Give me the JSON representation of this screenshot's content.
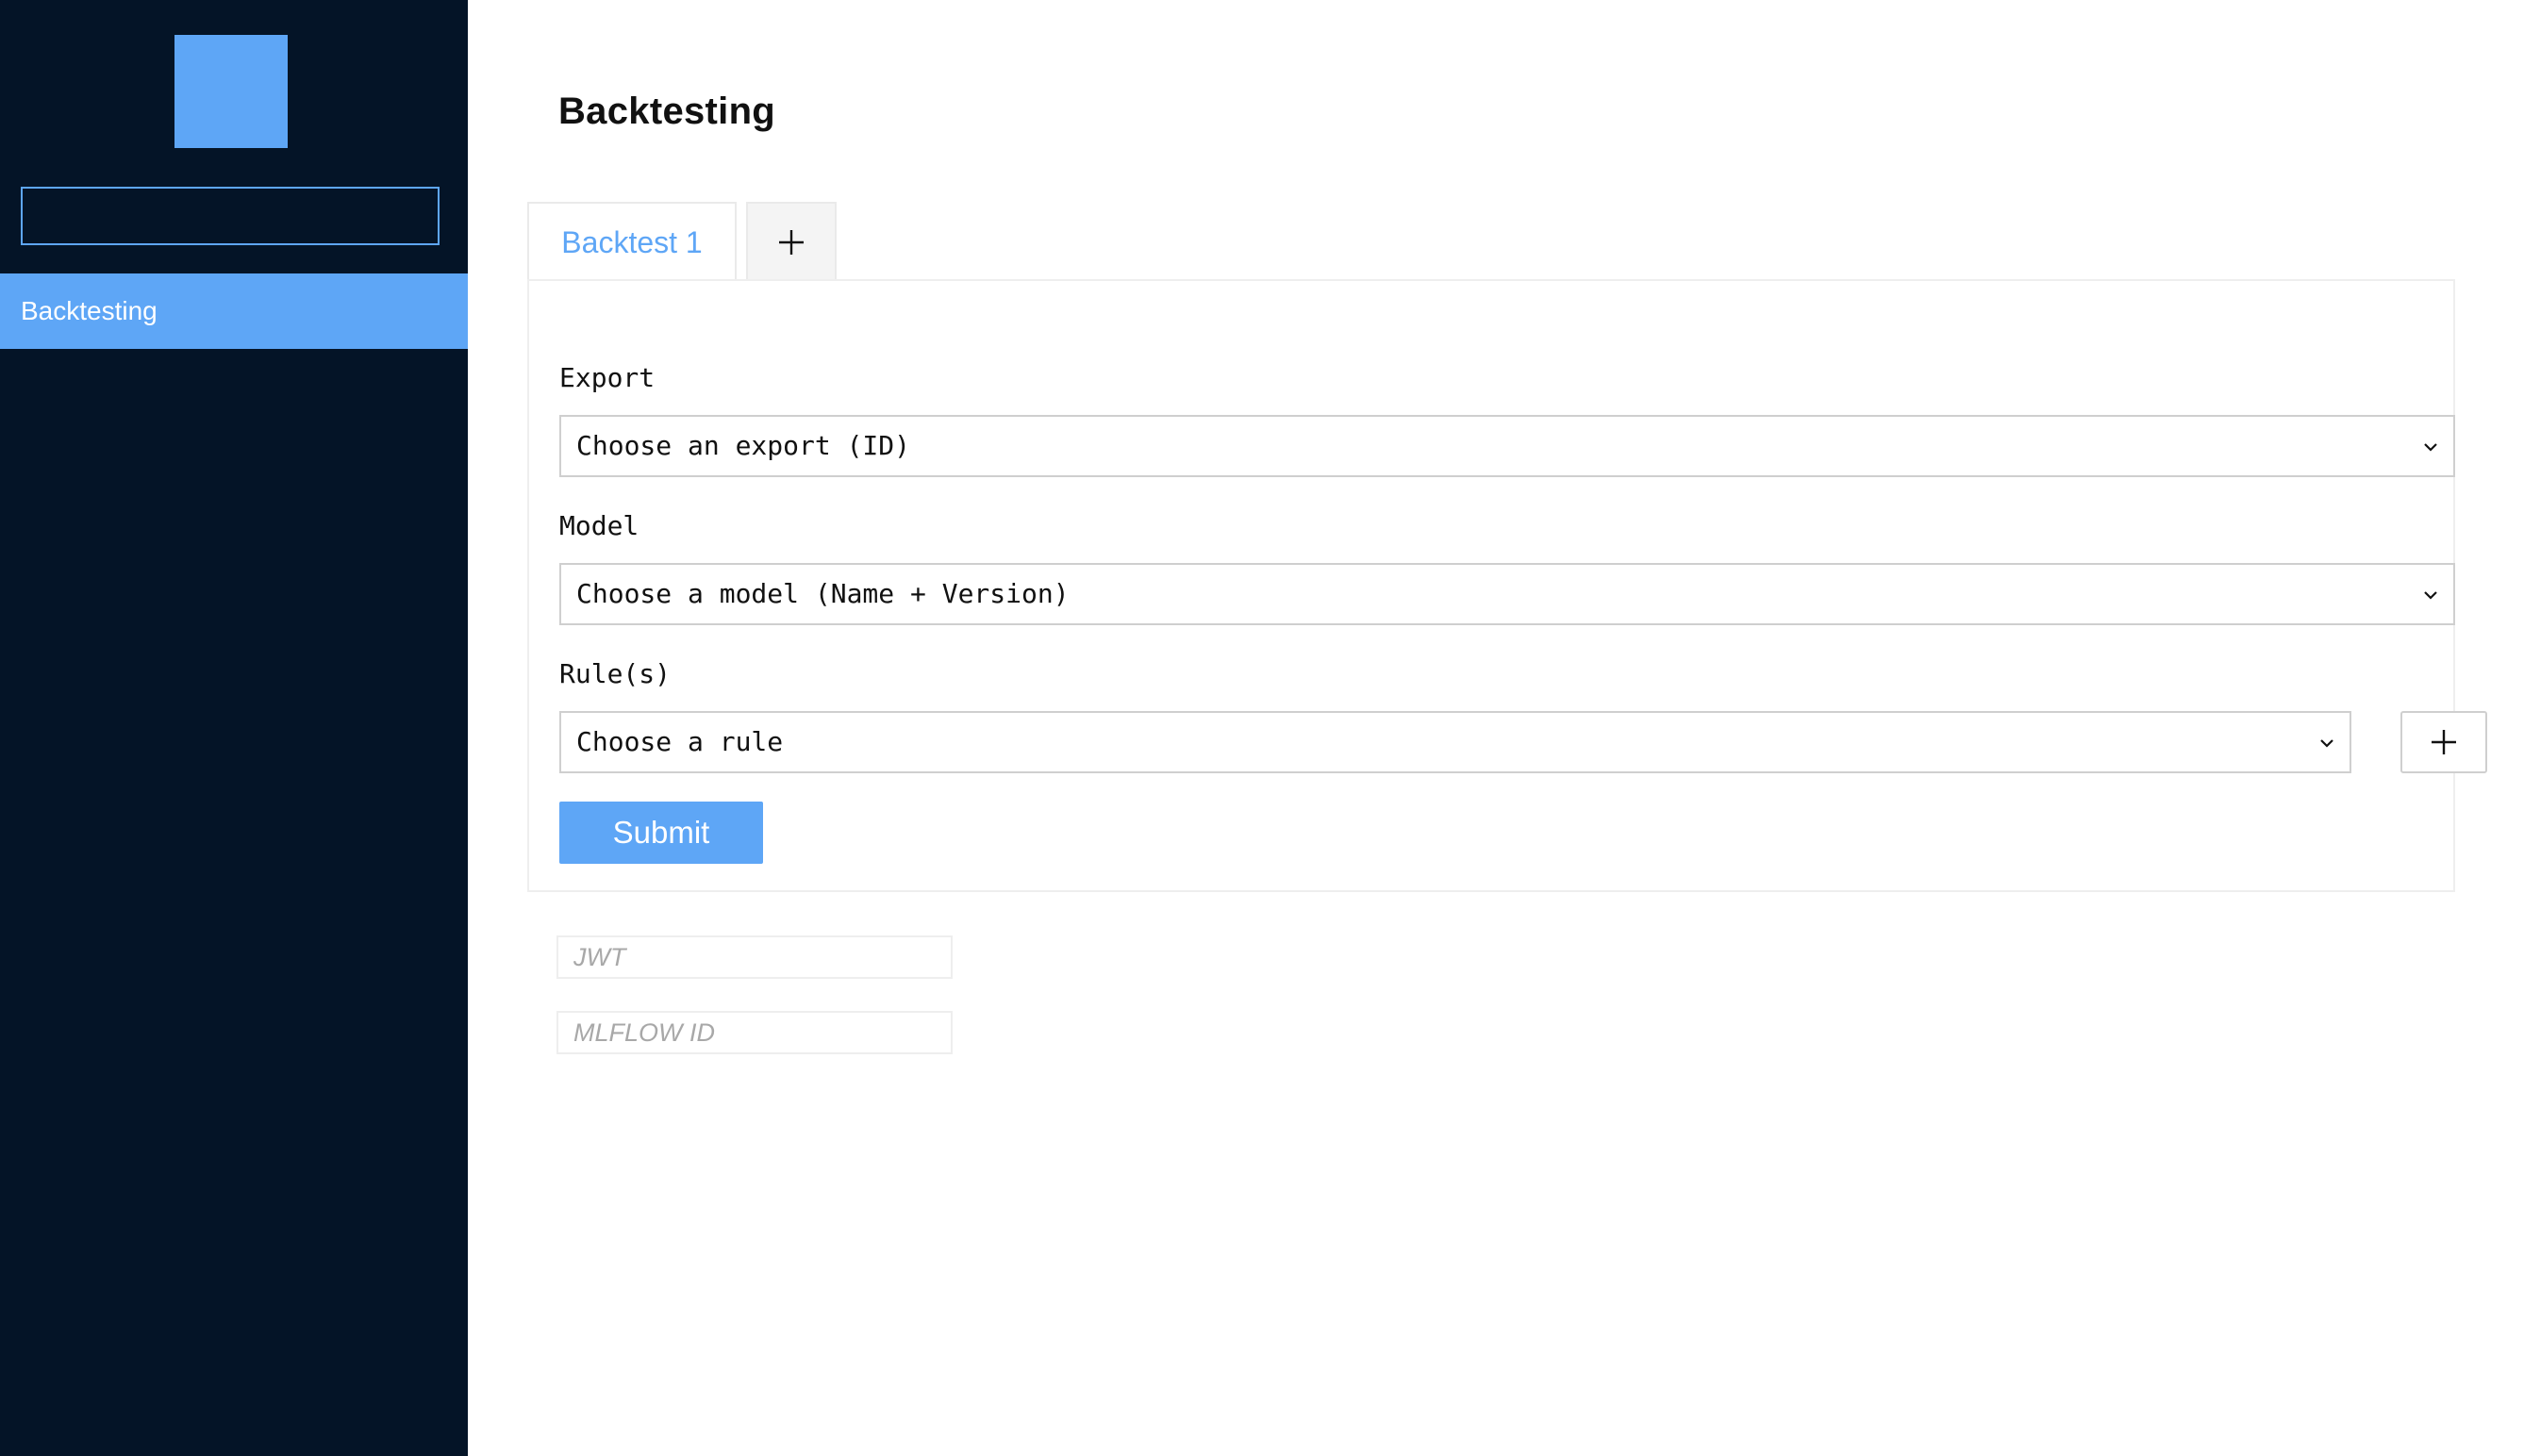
{
  "sidebar": {
    "logo": "logo",
    "search": {
      "value": "",
      "placeholder": ""
    },
    "items": [
      {
        "label": "Backtesting",
        "active": true
      }
    ]
  },
  "main": {
    "title": "Backtesting",
    "tabs": [
      {
        "label": "Backtest 1",
        "active": true
      }
    ],
    "add_tab_icon": "plus-icon",
    "form": {
      "export": {
        "label": "Export",
        "selected": "Choose an export (ID)"
      },
      "model": {
        "label": "Model",
        "selected": "Choose a model (Name + Version)"
      },
      "rules": {
        "label": "Rule(s)",
        "selected": "Choose a rule",
        "add_icon": "plus-icon"
      },
      "submit_label": "Submit"
    },
    "jwt": {
      "value": "",
      "placeholder": "JWT"
    },
    "mlflow": {
      "value": "",
      "placeholder": "MLFLOW ID"
    }
  },
  "colors": {
    "accent": "#5ea6f6",
    "sidebar_bg": "#041427",
    "text": "#111111"
  }
}
